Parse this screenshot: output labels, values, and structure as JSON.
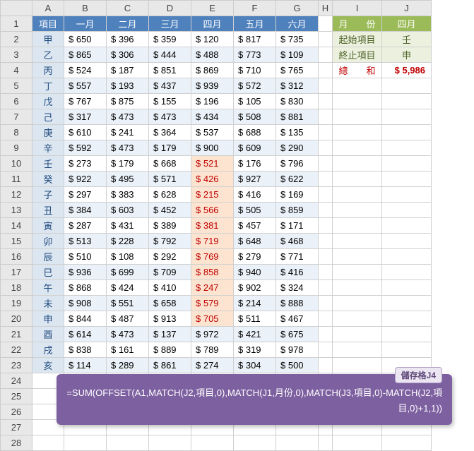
{
  "columns": [
    "A",
    "B",
    "C",
    "D",
    "E",
    "F",
    "G",
    "H",
    "I",
    "J"
  ],
  "rowCount": 28,
  "header": {
    "item": "項目",
    "months": [
      "一月",
      "二月",
      "三月",
      "四月",
      "五月",
      "六月"
    ]
  },
  "items": [
    "甲",
    "乙",
    "丙",
    "丁",
    "戊",
    "己",
    "庚",
    "辛",
    "壬",
    "癸",
    "子",
    "丑",
    "寅",
    "卯",
    "辰",
    "巳",
    "午",
    "未",
    "申",
    "酉",
    "戌",
    "亥"
  ],
  "table": [
    [
      650,
      396,
      359,
      120,
      817,
      735
    ],
    [
      865,
      306,
      444,
      488,
      773,
      109
    ],
    [
      524,
      187,
      851,
      869,
      710,
      765
    ],
    [
      557,
      193,
      437,
      939,
      572,
      312
    ],
    [
      767,
      875,
      155,
      196,
      105,
      830
    ],
    [
      317,
      473,
      473,
      434,
      508,
      881
    ],
    [
      610,
      241,
      364,
      537,
      688,
      135
    ],
    [
      592,
      473,
      179,
      900,
      609,
      290
    ],
    [
      273,
      179,
      668,
      521,
      176,
      796
    ],
    [
      922,
      495,
      571,
      426,
      927,
      622
    ],
    [
      297,
      383,
      628,
      215,
      416,
      169
    ],
    [
      384,
      603,
      452,
      566,
      505,
      859
    ],
    [
      287,
      431,
      389,
      381,
      457,
      171
    ],
    [
      513,
      228,
      792,
      719,
      648,
      468
    ],
    [
      510,
      108,
      292,
      769,
      279,
      771
    ],
    [
      936,
      699,
      709,
      858,
      940,
      416
    ],
    [
      868,
      424,
      410,
      247,
      902,
      324
    ],
    [
      908,
      551,
      658,
      579,
      214,
      888
    ],
    [
      844,
      487,
      913,
      705,
      511,
      467
    ],
    [
      614,
      473,
      137,
      972,
      421,
      675
    ],
    [
      838,
      161,
      889,
      789,
      319,
      978
    ],
    [
      114,
      289,
      861,
      274,
      304,
      500
    ]
  ],
  "highlight": {
    "col": 3,
    "rowStart": 8,
    "rowEnd": 18
  },
  "side": {
    "monthHdr": "月　　份",
    "monthVal": "四月",
    "startLbl": "起始項目",
    "startVal": "壬",
    "endLbl": "終止項目",
    "endVal": "申",
    "sumLbl": "總　　和",
    "sumVal": "$ 5,986"
  },
  "formula": {
    "tag": "儲存格J4",
    "text": "=SUM(OFFSET(A1,MATCH(J2,項目,0),MATCH(J1,月份,0),MATCH(J3,項目,0)-MATCH(J2,項目,0)+1,1))"
  },
  "chart_data": {
    "type": "table",
    "title": "Monthly values by item with SUM/OFFSET/MATCH demo",
    "categories": [
      "一月",
      "二月",
      "三月",
      "四月",
      "五月",
      "六月"
    ],
    "series": [
      {
        "name": "甲",
        "values": [
          650,
          396,
          359,
          120,
          817,
          735
        ]
      },
      {
        "name": "乙",
        "values": [
          865,
          306,
          444,
          488,
          773,
          109
        ]
      },
      {
        "name": "丙",
        "values": [
          524,
          187,
          851,
          869,
          710,
          765
        ]
      },
      {
        "name": "丁",
        "values": [
          557,
          193,
          437,
          939,
          572,
          312
        ]
      },
      {
        "name": "戊",
        "values": [
          767,
          875,
          155,
          196,
          105,
          830
        ]
      },
      {
        "name": "己",
        "values": [
          317,
          473,
          473,
          434,
          508,
          881
        ]
      },
      {
        "name": "庚",
        "values": [
          610,
          241,
          364,
          537,
          688,
          135
        ]
      },
      {
        "name": "辛",
        "values": [
          592,
          473,
          179,
          900,
          609,
          290
        ]
      },
      {
        "name": "壬",
        "values": [
          273,
          179,
          668,
          521,
          176,
          796
        ]
      },
      {
        "name": "癸",
        "values": [
          922,
          495,
          571,
          426,
          927,
          622
        ]
      },
      {
        "name": "子",
        "values": [
          297,
          383,
          628,
          215,
          416,
          169
        ]
      },
      {
        "name": "丑",
        "values": [
          384,
          603,
          452,
          566,
          505,
          859
        ]
      },
      {
        "name": "寅",
        "values": [
          287,
          431,
          389,
          381,
          457,
          171
        ]
      },
      {
        "name": "卯",
        "values": [
          513,
          228,
          792,
          719,
          648,
          468
        ]
      },
      {
        "name": "辰",
        "values": [
          510,
          108,
          292,
          769,
          279,
          771
        ]
      },
      {
        "name": "巳",
        "values": [
          936,
          699,
          709,
          858,
          940,
          416
        ]
      },
      {
        "name": "午",
        "values": [
          868,
          424,
          410,
          247,
          902,
          324
        ]
      },
      {
        "name": "未",
        "values": [
          908,
          551,
          658,
          579,
          214,
          888
        ]
      },
      {
        "name": "申",
        "values": [
          844,
          487,
          913,
          705,
          511,
          467
        ]
      },
      {
        "name": "酉",
        "values": [
          614,
          473,
          137,
          972,
          421,
          675
        ]
      },
      {
        "name": "戌",
        "values": [
          838,
          161,
          889,
          789,
          319,
          978
        ]
      },
      {
        "name": "亥",
        "values": [
          114,
          289,
          861,
          274,
          304,
          500
        ]
      }
    ],
    "highlight_sum": 5986
  }
}
